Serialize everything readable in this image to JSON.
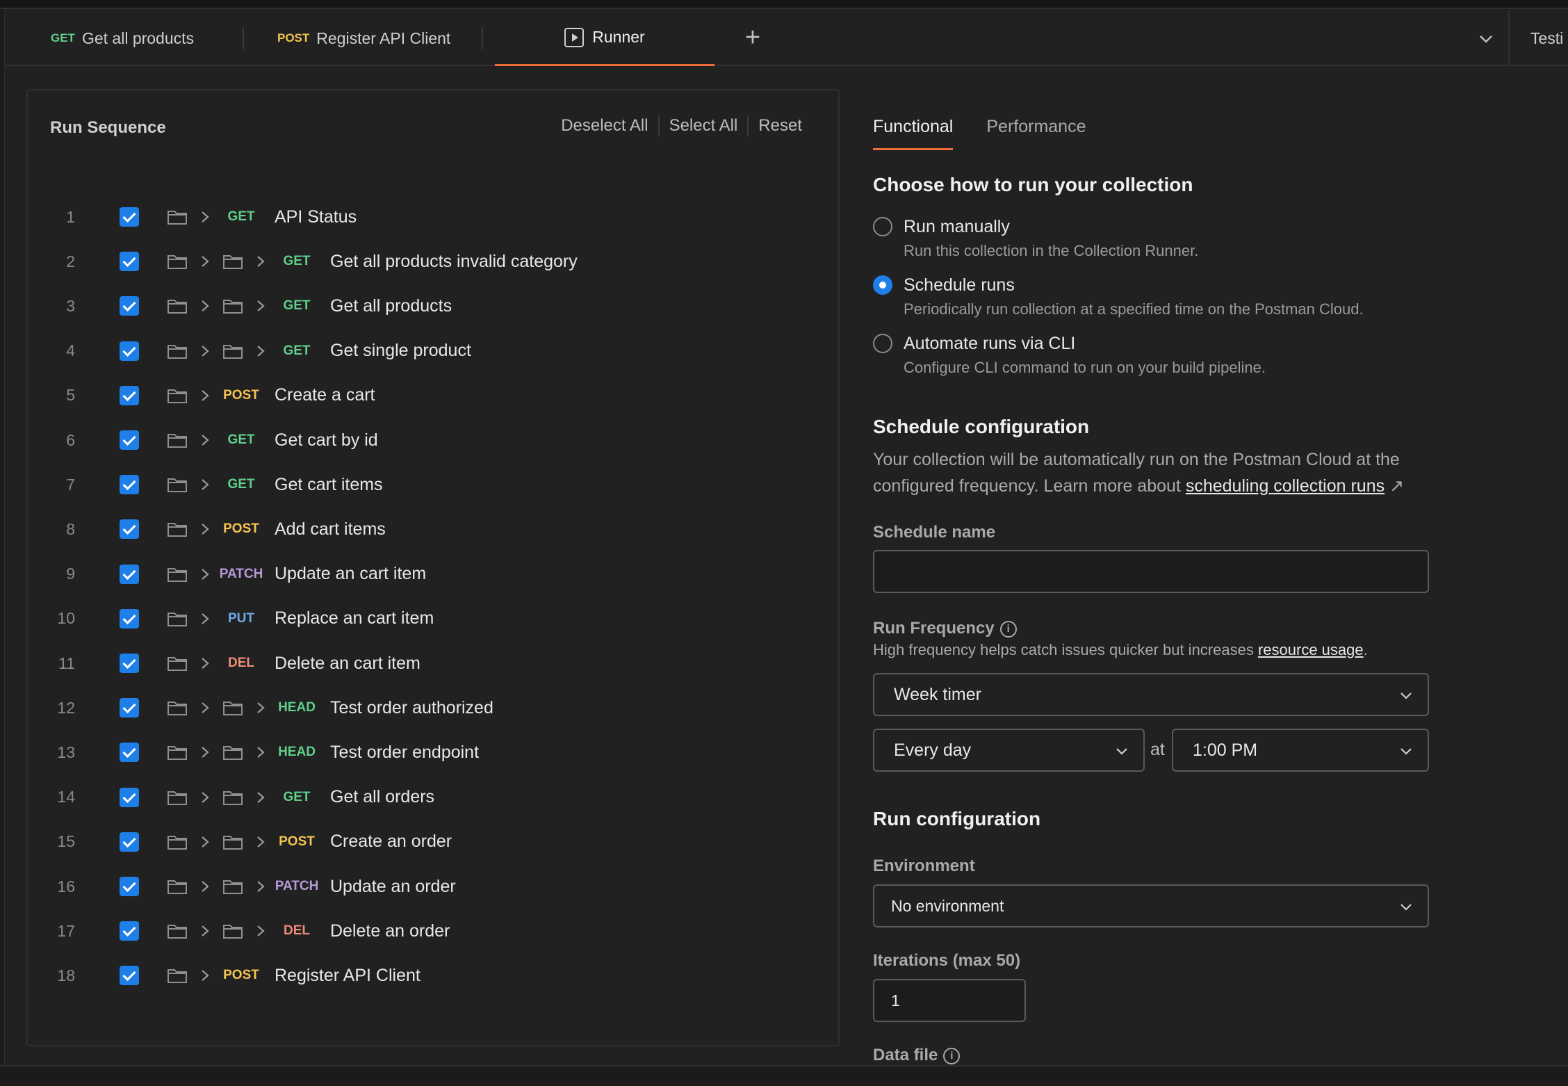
{
  "tabs": [
    {
      "method": "GET",
      "label": "Get all products"
    },
    {
      "method": "POST",
      "label": "Register API Client"
    },
    {
      "label": "Runner"
    }
  ],
  "env_tab_label": "Testi",
  "sequence": {
    "title": "Run Sequence",
    "actions": {
      "deselect": "Deselect All",
      "select": "Select All",
      "reset": "Reset"
    },
    "rows": [
      {
        "n": "1",
        "method": "GET",
        "name": "API Status",
        "depth": 1
      },
      {
        "n": "2",
        "method": "GET",
        "name": "Get all products invalid category",
        "depth": 2
      },
      {
        "n": "3",
        "method": "GET",
        "name": "Get all products",
        "depth": 2
      },
      {
        "n": "4",
        "method": "GET",
        "name": "Get single product",
        "depth": 2
      },
      {
        "n": "5",
        "method": "POST",
        "name": "Create a cart",
        "depth": 1
      },
      {
        "n": "6",
        "method": "GET",
        "name": "Get cart by id",
        "depth": 1
      },
      {
        "n": "7",
        "method": "GET",
        "name": "Get cart items",
        "depth": 1
      },
      {
        "n": "8",
        "method": "POST",
        "name": "Add cart items",
        "depth": 1
      },
      {
        "n": "9",
        "method": "PATCH",
        "name": "Update an cart item",
        "depth": 1
      },
      {
        "n": "10",
        "method": "PUT",
        "name": "Replace an cart item",
        "depth": 1
      },
      {
        "n": "11",
        "method": "DEL",
        "name": "Delete an cart item",
        "depth": 1
      },
      {
        "n": "12",
        "method": "HEAD",
        "name": "Test order authorized",
        "depth": 2
      },
      {
        "n": "13",
        "method": "HEAD",
        "name": "Test order endpoint",
        "depth": 2
      },
      {
        "n": "14",
        "method": "GET",
        "name": "Get all orders",
        "depth": 2
      },
      {
        "n": "15",
        "method": "POST",
        "name": "Create an order",
        "depth": 2
      },
      {
        "n": "16",
        "method": "PATCH",
        "name": "Update an order",
        "depth": 2
      },
      {
        "n": "17",
        "method": "DEL",
        "name": "Delete an order",
        "depth": 2
      },
      {
        "n": "18",
        "method": "POST",
        "name": "Register API Client",
        "depth": 1
      }
    ]
  },
  "right": {
    "tabs": {
      "functional": "Functional",
      "performance": "Performance"
    },
    "choose_title": "Choose how to run your collection",
    "options": [
      {
        "label": "Run manually",
        "desc": "Run this collection in the Collection Runner.",
        "selected": false
      },
      {
        "label": "Schedule runs",
        "desc": "Periodically run collection at a specified time on the Postman Cloud.",
        "selected": true
      },
      {
        "label": "Automate runs via CLI",
        "desc": "Configure CLI command to run on your build pipeline.",
        "selected": false
      }
    ],
    "schedule_title": "Schedule configuration",
    "schedule_desc": "Your collection will be automatically run on the Postman Cloud at the configured frequency. Learn more about",
    "schedule_link": "scheduling collection runs",
    "schedule_name_label": "Schedule name",
    "schedule_name_value": "",
    "run_freq_label": "Run Frequency",
    "run_freq_hint": "High frequency helps catch issues quicker but increases",
    "run_freq_link": "resource usage",
    "frequency": "Week timer",
    "day": "Every day",
    "at": "at",
    "time": "1:00 PM",
    "run_config_title": "Run configuration",
    "environment_label": "Environment",
    "environment": "No environment",
    "iterations_label": "Iterations (max 50)",
    "iterations": "1",
    "data_file_label": "Data file"
  },
  "colors": {
    "accent": "#f26b3a",
    "checkbox": "#1e7fe8"
  }
}
